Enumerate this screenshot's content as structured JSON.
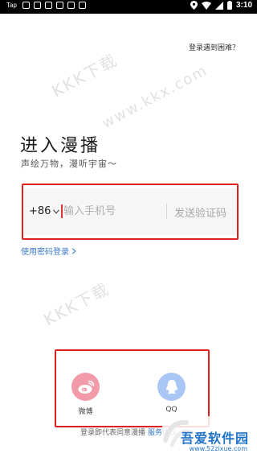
{
  "status_bar": {
    "app_name": "Tap",
    "time": "3:10"
  },
  "header": {
    "help_link": "登录遇到困难？"
  },
  "watermarks": [
    "KKK下载",
    "www.kkx.com",
    "KKK下载"
  ],
  "main": {
    "title": "进入漫播",
    "subtitle": "声绘万物，漫听宇宙～",
    "country_code": "+86",
    "phone_placeholder": "输入手机号",
    "send_code_label": "发送验证码",
    "password_login_label": "使用密码登录"
  },
  "social_login": [
    {
      "label": "微博",
      "icon": "weibo-icon",
      "color": "#f29aa8"
    },
    {
      "label": "QQ",
      "icon": "qq-icon",
      "color": "#a9c6f5"
    }
  ],
  "footer": {
    "agreement_prefix": "登录即代表同意漫播",
    "agreement_link": "服务协议"
  },
  "site_watermark": {
    "name": "吾爱软件园",
    "url": "www.52zixue.com"
  },
  "colors": {
    "highlight_box": "#e02020",
    "link": "#3b79c9",
    "weibo": "#f29aa8",
    "qq": "#a9c6f5"
  }
}
